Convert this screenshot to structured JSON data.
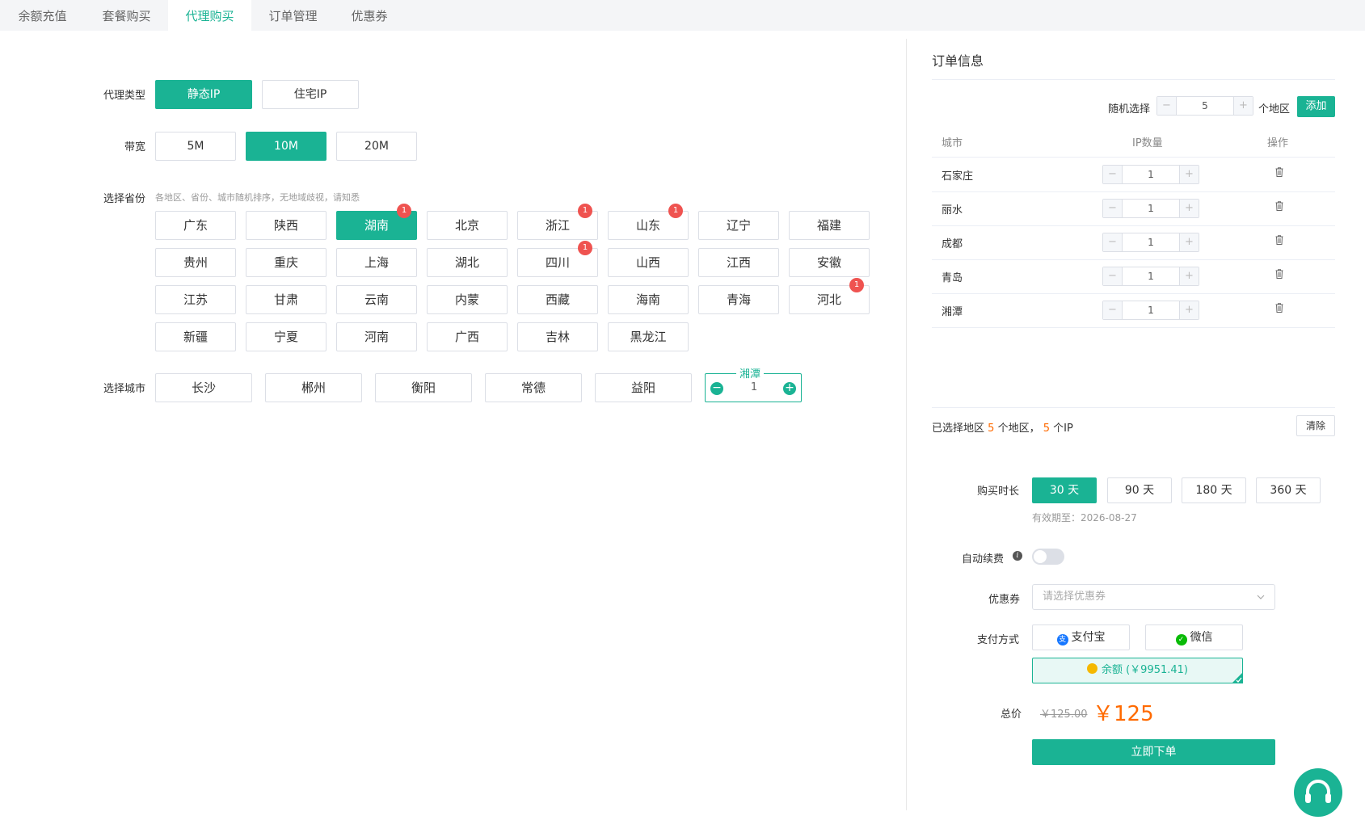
{
  "tabs": [
    "余额充值",
    "套餐购买",
    "代理购买",
    "订单管理",
    "优惠券"
  ],
  "form": {
    "proxy_type_label": "代理类型",
    "proxy_types": [
      "静态IP",
      "住宅IP"
    ],
    "bandwidth_label": "带宽",
    "bandwidths": [
      "5M",
      "10M",
      "20M"
    ],
    "province_label": "选择省份",
    "province_hint": "各地区、省份、城市随机排序，无地域歧视，请知悉",
    "provinces": [
      "广东",
      "陕西",
      "湖南",
      "北京",
      "浙江",
      "山东",
      "辽宁",
      "福建",
      "贵州",
      "重庆",
      "上海",
      "湖北",
      "四川",
      "山西",
      "江西",
      "安徽",
      "江苏",
      "甘肃",
      "云南",
      "内蒙",
      "西藏",
      "海南",
      "青海",
      "河北",
      "新疆",
      "宁夏",
      "河南",
      "广西",
      "吉林",
      "黑龙江"
    ],
    "province_badges": {
      "湖南": "1",
      "浙江": "1",
      "山东": "1",
      "四川": "1",
      "河北": "1"
    },
    "city_label": "选择城市",
    "cities": [
      "长沙",
      "郴州",
      "衡阳",
      "常德",
      "益阳"
    ],
    "stepper_city": "湘潭",
    "stepper_value": "1",
    "minus": "−",
    "plus": "+"
  },
  "order": {
    "title": "订单信息",
    "random_label": "随机选择",
    "random_value": "5",
    "random_unit": "个地区",
    "add": "添加",
    "headers": [
      "城市",
      "IP数量",
      "操作"
    ],
    "rows": [
      {
        "city": "石家庄",
        "qty": "1"
      },
      {
        "city": "丽水",
        "qty": "1"
      },
      {
        "city": "成都",
        "qty": "1"
      },
      {
        "city": "青岛",
        "qty": "1"
      },
      {
        "city": "湘潭",
        "qty": "1"
      }
    ],
    "summary_prefix": "已选择地区",
    "region_count": "5",
    "summary_mid": "个地区，",
    "ip_count": "5",
    "summary_suffix": "个IP",
    "clear": "清除",
    "duration_label": "购买时长",
    "durations": [
      "30 天",
      "90 天",
      "180 天",
      "360 天"
    ],
    "expiry": "有效期至：2026-08-27",
    "autorenew_label": "自动续费",
    "coupon_label": "优惠券",
    "coupon_placeholder": "请选择优惠券",
    "pay_label": "支付方式",
    "alipay": "支付宝",
    "wechat": "微信",
    "balance": "余额 (￥9951.41)",
    "total_label": "总价",
    "original_price": "￥125.00",
    "price": "￥125",
    "submit": "立即下单"
  },
  "colors": {
    "accent": "#1ab394",
    "badge": "#ef5350",
    "price": "#ff6a00"
  },
  "icons": [
    "trash-icon",
    "info-icon",
    "chevron-down-icon",
    "alipay-icon",
    "wechat-icon",
    "coin-icon",
    "headset-icon"
  ]
}
